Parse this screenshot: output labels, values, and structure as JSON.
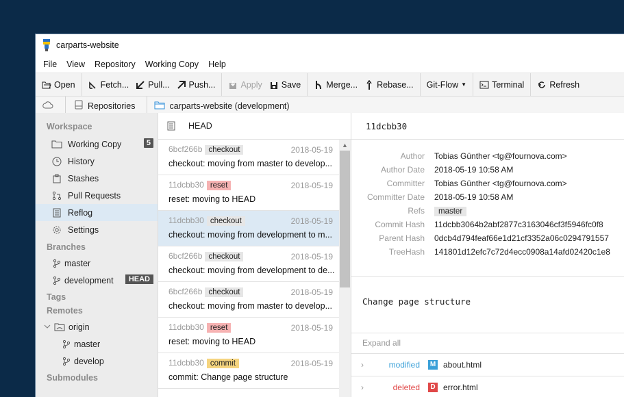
{
  "window": {
    "title": "carparts-website"
  },
  "menu": [
    "File",
    "View",
    "Repository",
    "Working Copy",
    "Help"
  ],
  "toolbar": {
    "open": "Open",
    "fetch": "Fetch...",
    "pull": "Pull...",
    "push": "Push...",
    "apply": "Apply",
    "save": "Save",
    "merge": "Merge...",
    "rebase": "Rebase...",
    "gitflow": "Git-Flow",
    "terminal": "Terminal",
    "refresh": "Refresh"
  },
  "breadcrumb": {
    "repositories": "Repositories",
    "current": "carparts-website (development)"
  },
  "sidebar": {
    "workspace_header": "Workspace",
    "workspace": [
      {
        "label": "Working Copy",
        "count": "5"
      },
      {
        "label": "History"
      },
      {
        "label": "Stashes"
      },
      {
        "label": "Pull Requests"
      },
      {
        "label": "Reflog"
      },
      {
        "label": "Settings"
      }
    ],
    "branches_header": "Branches",
    "branches": [
      {
        "label": "master"
      },
      {
        "label": "development",
        "tag": "HEAD"
      }
    ],
    "tags_header": "Tags",
    "remotes_header": "Remotes",
    "remote": {
      "label": "origin",
      "branches": [
        "master",
        "develop"
      ]
    },
    "submodules_header": "Submodules"
  },
  "reflog": {
    "header": "HEAD",
    "entries": [
      {
        "hash": "6bcf266b",
        "action": "checkout",
        "date": "2018-05-19",
        "message": "checkout: moving from master to develop..."
      },
      {
        "hash": "11dcbb30",
        "action": "reset",
        "date": "2018-05-19",
        "message": "reset: moving to HEAD"
      },
      {
        "hash": "11dcbb30",
        "action": "checkout",
        "date": "2018-05-19",
        "message": "checkout: moving from development to m..."
      },
      {
        "hash": "6bcf266b",
        "action": "checkout",
        "date": "2018-05-19",
        "message": "checkout: moving from development to de..."
      },
      {
        "hash": "6bcf266b",
        "action": "checkout",
        "date": "2018-05-19",
        "message": "checkout: moving from master to develop..."
      },
      {
        "hash": "11dcbb30",
        "action": "reset",
        "date": "2018-05-19",
        "message": "reset: moving to HEAD"
      },
      {
        "hash": "11dcbb30",
        "action": "commit",
        "date": "2018-05-19",
        "message": "commit: Change page structure"
      }
    ]
  },
  "detail": {
    "short_hash": "11dcbb30",
    "author_label": "Author",
    "author": "Tobias Günther <tg@fournova.com>",
    "author_date_label": "Author Date",
    "author_date": "2018-05-19 10:58 AM",
    "committer_label": "Committer",
    "committer": "Tobias Günther <tg@fournova.com>",
    "committer_date_label": "Committer Date",
    "committer_date": "2018-05-19 10:58 AM",
    "refs_label": "Refs",
    "refs": "master",
    "commit_hash_label": "Commit Hash",
    "commit_hash": "11dcbb3064b2abf2877c3163046cf3f5946fc0f8",
    "parent_hash_label": "Parent Hash",
    "parent_hash": "0dcb4d794feaf66e1d21cf3352a06c0294791557",
    "tree_hash_label": "TreeHash",
    "tree_hash": "141801d12efc7c72d4ecc0908a14afd02420c1e8",
    "message": "Change page structure",
    "expand_all": "Expand all",
    "files": [
      {
        "status": "modified",
        "badge": "M",
        "name": "about.html",
        "color": "#3aa0d8"
      },
      {
        "status": "deleted",
        "badge": "D",
        "name": "error.html",
        "color": "#e04848"
      }
    ]
  }
}
